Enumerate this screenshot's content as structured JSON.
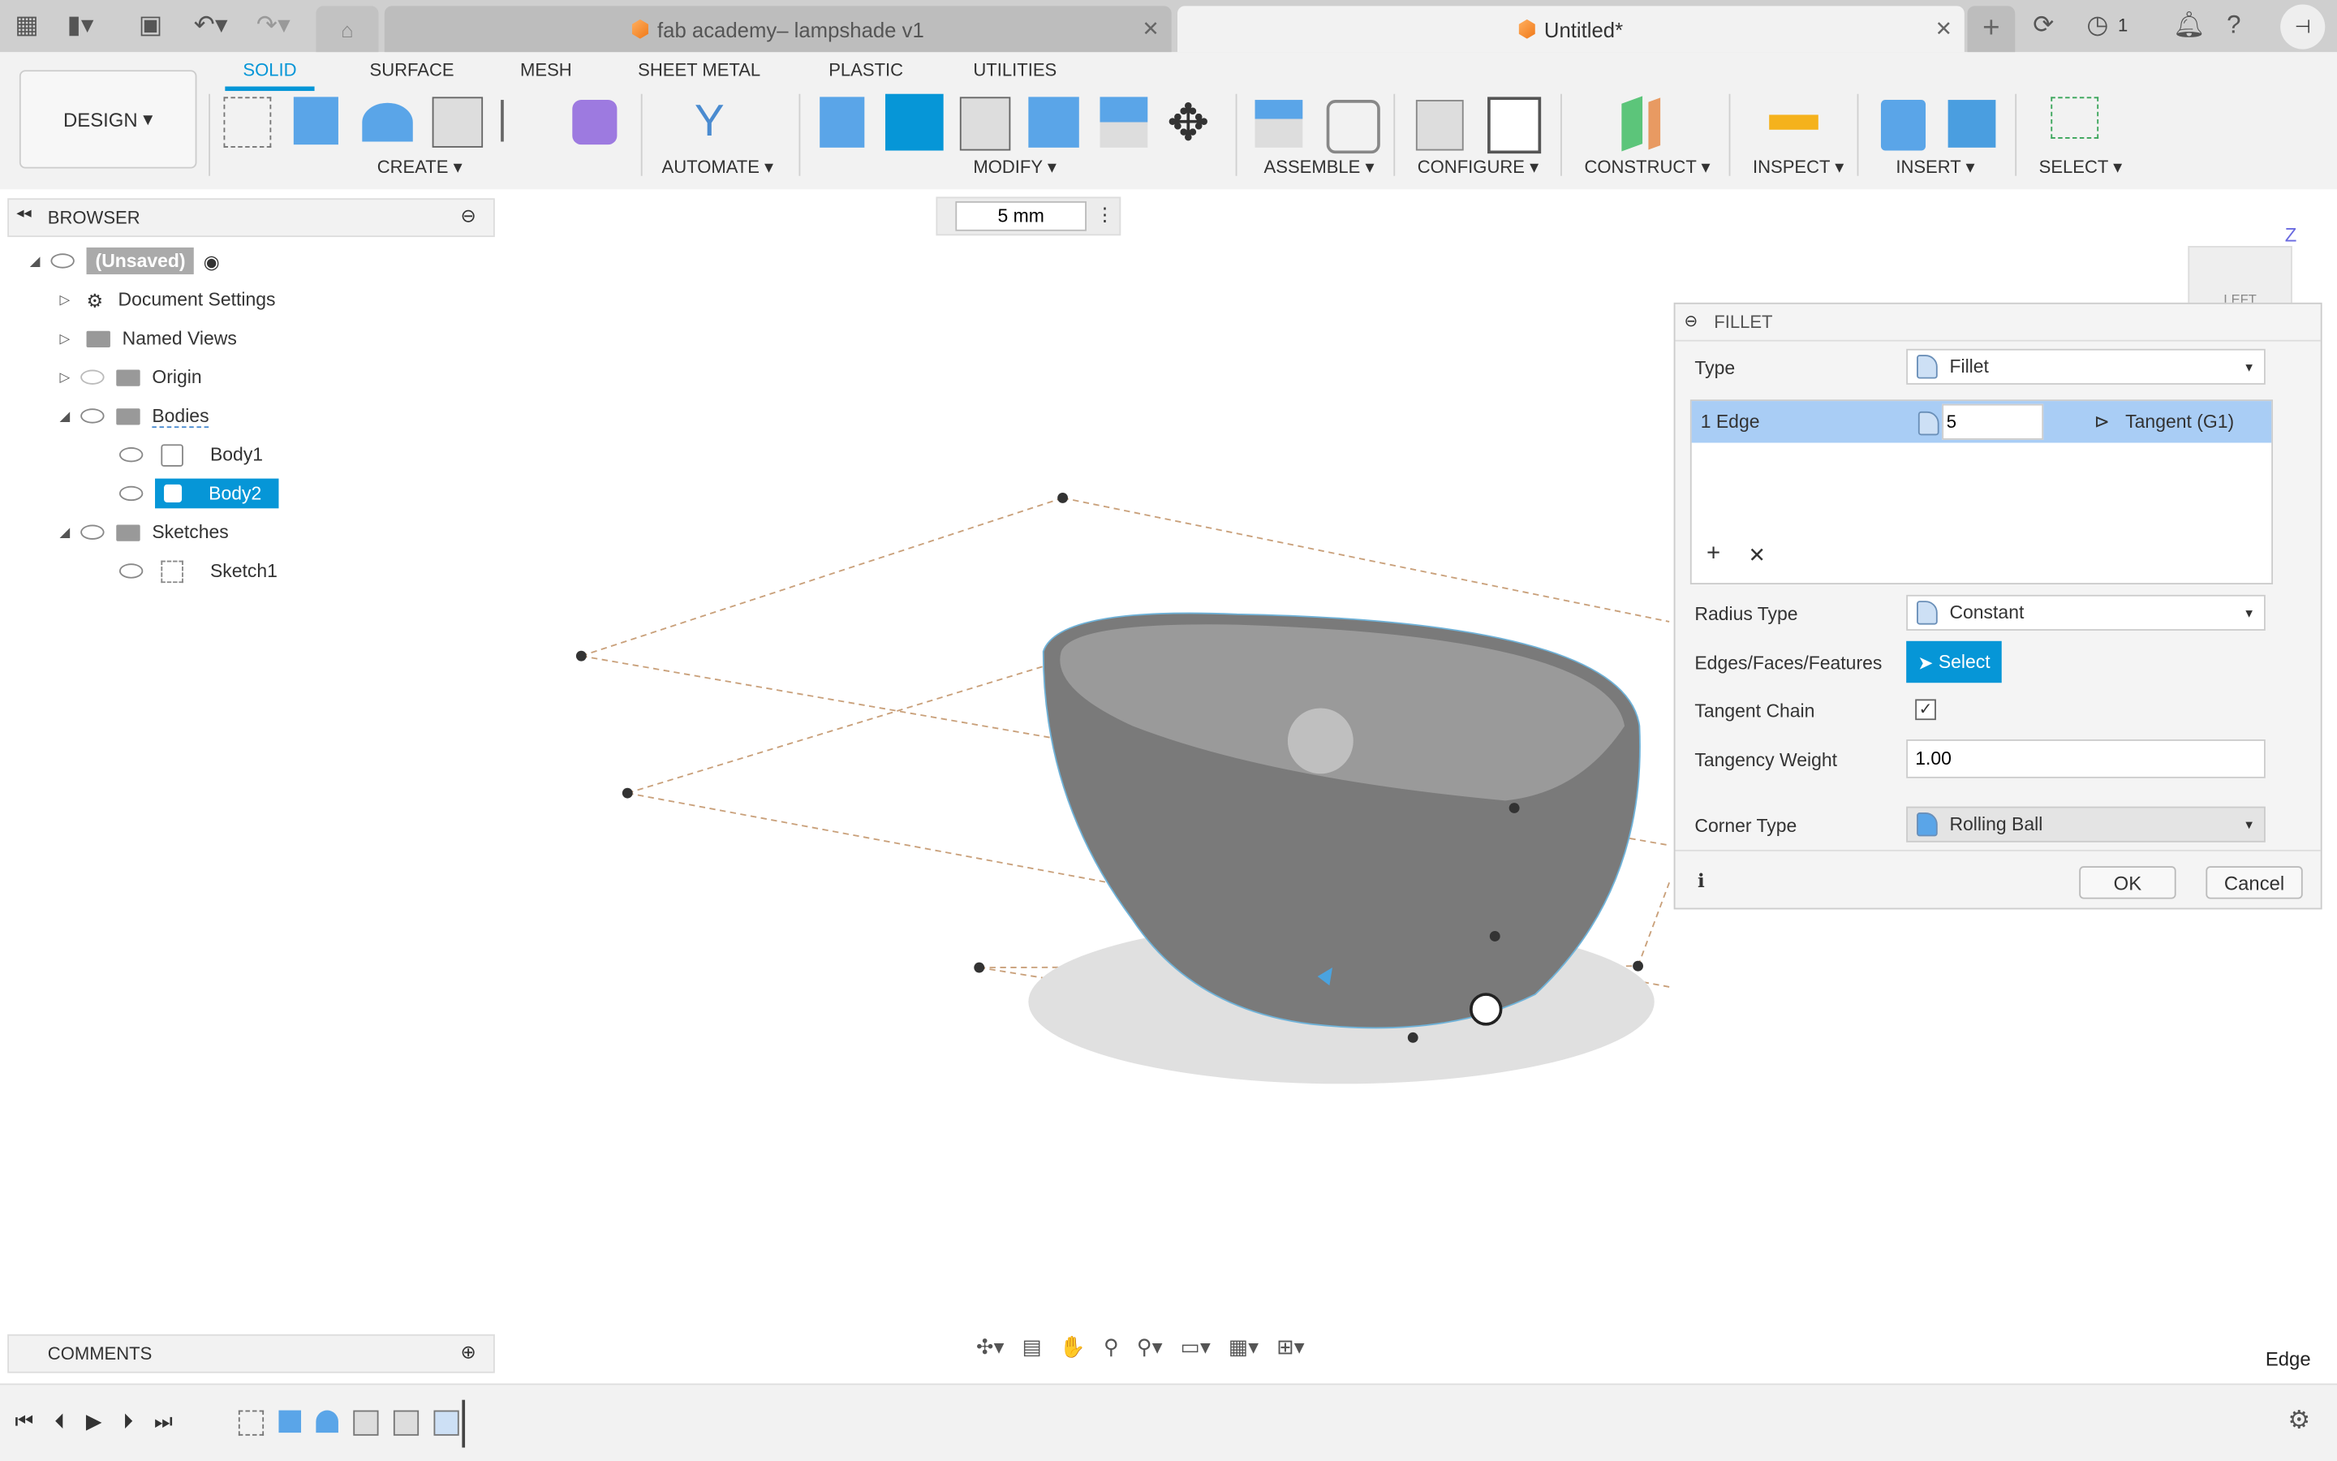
{
  "tabs": [
    {
      "label": "fab academy– lampshade v1",
      "active": false
    },
    {
      "label": "Untitled*",
      "active": true
    }
  ],
  "topbar": {
    "job_count": "1"
  },
  "workspace": {
    "label": "DESIGN"
  },
  "ribbon_tabs": [
    "SOLID",
    "SURFACE",
    "MESH",
    "SHEET METAL",
    "PLASTIC",
    "UTILITIES"
  ],
  "ribbon_groups": [
    "CREATE",
    "AUTOMATE",
    "MODIFY",
    "ASSEMBLE",
    "CONFIGURE",
    "CONSTRUCT",
    "INSPECT",
    "INSERT",
    "SELECT"
  ],
  "browser": {
    "title": "BROWSER",
    "items": [
      {
        "label": "(Unsaved)",
        "level": 0
      },
      {
        "label": "Document Settings",
        "level": 1
      },
      {
        "label": "Named Views",
        "level": 1
      },
      {
        "label": "Origin",
        "level": 1
      },
      {
        "label": "Bodies",
        "level": 1
      },
      {
        "label": "Body1",
        "level": 2
      },
      {
        "label": "Body2",
        "level": 2,
        "selected": true
      },
      {
        "label": "Sketches",
        "level": 1
      },
      {
        "label": "Sketch1",
        "level": 2
      }
    ]
  },
  "value_input": "5 mm",
  "viewcube": {
    "face": "LEFT",
    "axis": "Z"
  },
  "fillet": {
    "title": "FILLET",
    "type_label": "Type",
    "type_value": "Fillet",
    "edge_label": "1 Edge",
    "edge_value": "5",
    "edge_continuity": "Tangent (G1)",
    "radius_type_label": "Radius Type",
    "radius_type_value": "Constant",
    "edges_label": "Edges/Faces/Features",
    "select_label": "Select",
    "tangent_chain_label": "Tangent Chain",
    "tangent_chain": true,
    "tangency_weight_label": "Tangency Weight",
    "tangency_weight": "1.00",
    "corner_type_label": "Corner Type",
    "corner_type_value": "Rolling Ball",
    "ok": "OK",
    "cancel": "Cancel"
  },
  "comments": {
    "title": "COMMENTS"
  },
  "status": "Edge",
  "colors": {
    "accent": "#0696d7",
    "selection": "#a9cdf5"
  }
}
